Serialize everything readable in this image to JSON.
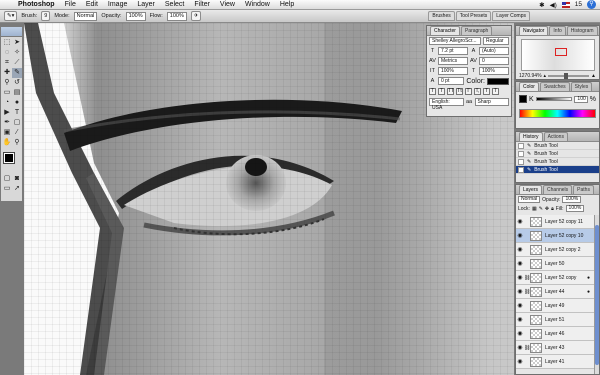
{
  "menubar": {
    "app": "Photoshop",
    "items": [
      "File",
      "Edit",
      "Image",
      "Layer",
      "Select",
      "Filter",
      "View",
      "Window",
      "Help"
    ],
    "right_badge": "15"
  },
  "options": {
    "brush_label": "Brush:",
    "brush_size": "9",
    "mode_label": "Mode:",
    "mode_value": "Normal",
    "opacity_label": "Opacity:",
    "opacity_value": "100%",
    "flow_label": "Flow:",
    "flow_value": "100%",
    "well_tabs": [
      "Brushes",
      "Tool Presets",
      "Layer Comps"
    ]
  },
  "character": {
    "tabs": [
      "Character",
      "Paragraph"
    ],
    "font_family": "Shelley AllegroScr...",
    "font_style": "Regular",
    "size": "7.2 pt",
    "leading": "(Auto)",
    "kerning": "Metrics",
    "tracking": "0",
    "vscale": "100%",
    "hscale": "100%",
    "baseline": "0 pt",
    "color_label": "Color:",
    "language": "English: USA",
    "antialias": "Sharp",
    "style_buttons": [
      "T",
      "T",
      "TT",
      "Tt",
      "T'",
      "T,",
      "T",
      "T"
    ]
  },
  "navigator": {
    "tabs": [
      "Navigator",
      "Info",
      "Histogram"
    ],
    "zoom": "1270.94%"
  },
  "color": {
    "tabs": [
      "Color",
      "Swatches",
      "Styles"
    ],
    "channel": "K",
    "value": "100",
    "unit": "%"
  },
  "history": {
    "tabs": [
      "History",
      "Actions"
    ],
    "items": [
      "Brush Tool",
      "Brush Tool",
      "Brush Tool",
      "Brush Tool"
    ]
  },
  "layers": {
    "tabs": [
      "Layers",
      "Channels",
      "Paths"
    ],
    "blend_mode": "Normal",
    "opacity_label": "Opacity:",
    "opacity": "100%",
    "lock_label": "Lock:",
    "fill_label": "Fill:",
    "fill": "100%",
    "items": [
      {
        "name": "Layer 52 copy 11",
        "selected": false
      },
      {
        "name": "Layer 52 copy 10",
        "selected": true
      },
      {
        "name": "Layer 52 copy 2",
        "selected": false
      },
      {
        "name": "Layer 50",
        "selected": false
      },
      {
        "name": "Layer 52 copy",
        "selected": false
      },
      {
        "name": "Layer 44",
        "selected": false
      },
      {
        "name": "Layer 49",
        "selected": false
      },
      {
        "name": "Layer 51",
        "selected": false
      },
      {
        "name": "Layer 46",
        "selected": false
      },
      {
        "name": "Layer 43",
        "selected": false
      },
      {
        "name": "Layer 41",
        "selected": false
      }
    ]
  },
  "colors": {
    "selection": "#1a3f8a",
    "layer_selected": "#b7cbe8",
    "foreground": "#000000",
    "background": "#ffffff"
  }
}
